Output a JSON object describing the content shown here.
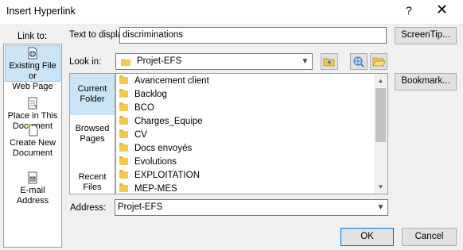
{
  "window": {
    "title": "Insert Hyperlink",
    "help_glyph": "?",
    "close_glyph": "✕"
  },
  "link_to": {
    "label": "Link to:",
    "items": [
      {
        "label_1": "Existing File or",
        "label_2": "Web Page",
        "icon": "web-page-icon",
        "selected": true
      },
      {
        "label_1": "Place in This",
        "label_2": "Document",
        "icon": "place-document-icon"
      },
      {
        "label_1": "Create New",
        "label_2": "Document",
        "icon": "new-document-icon"
      },
      {
        "label_1": "E-mail Address",
        "label_2": "",
        "icon": "email-icon"
      }
    ]
  },
  "text_to_display": {
    "label": "Text to display:",
    "value": "discriminations"
  },
  "screentip": {
    "label": "ScreenTip..."
  },
  "look_in": {
    "label": "Look in:",
    "value": "Projet-EFS"
  },
  "subnav": {
    "items": [
      {
        "label_1": "Current",
        "label_2": "Folder",
        "selected": true
      },
      {
        "label_1": "Browsed",
        "label_2": "Pages"
      },
      {
        "label_1": "Recent Files",
        "label_2": ""
      }
    ]
  },
  "files": [
    "Avancement client",
    "Backlog",
    "BCO",
    "Charges_Equipe",
    "CV",
    "Docs envoyés",
    "Evolutions",
    "EXPLOITATION",
    "MEP-MES"
  ],
  "bookmark": {
    "label": "Bookmark..."
  },
  "address": {
    "label": "Address:",
    "value": "Projet-EFS"
  },
  "buttons": {
    "ok": "OK",
    "cancel": "Cancel"
  },
  "colors": {
    "selected_bg": "#cce4f7",
    "accent": "#0078d7",
    "folder": "#f3c94f"
  }
}
